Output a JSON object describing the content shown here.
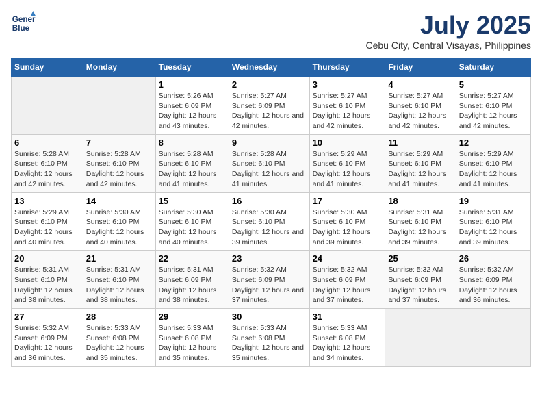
{
  "header": {
    "logo_line1": "General",
    "logo_line2": "Blue",
    "title": "July 2025",
    "subtitle": "Cebu City, Central Visayas, Philippines"
  },
  "calendar": {
    "headers": [
      "Sunday",
      "Monday",
      "Tuesday",
      "Wednesday",
      "Thursday",
      "Friday",
      "Saturday"
    ],
    "weeks": [
      [
        {
          "day": "",
          "sunrise": "",
          "sunset": "",
          "daylight": "",
          "empty": true
        },
        {
          "day": "",
          "sunrise": "",
          "sunset": "",
          "daylight": "",
          "empty": true
        },
        {
          "day": "1",
          "sunrise": "Sunrise: 5:26 AM",
          "sunset": "Sunset: 6:09 PM",
          "daylight": "Daylight: 12 hours and 43 minutes.",
          "empty": false
        },
        {
          "day": "2",
          "sunrise": "Sunrise: 5:27 AM",
          "sunset": "Sunset: 6:09 PM",
          "daylight": "Daylight: 12 hours and 42 minutes.",
          "empty": false
        },
        {
          "day": "3",
          "sunrise": "Sunrise: 5:27 AM",
          "sunset": "Sunset: 6:10 PM",
          "daylight": "Daylight: 12 hours and 42 minutes.",
          "empty": false
        },
        {
          "day": "4",
          "sunrise": "Sunrise: 5:27 AM",
          "sunset": "Sunset: 6:10 PM",
          "daylight": "Daylight: 12 hours and 42 minutes.",
          "empty": false
        },
        {
          "day": "5",
          "sunrise": "Sunrise: 5:27 AM",
          "sunset": "Sunset: 6:10 PM",
          "daylight": "Daylight: 12 hours and 42 minutes.",
          "empty": false
        }
      ],
      [
        {
          "day": "6",
          "sunrise": "Sunrise: 5:28 AM",
          "sunset": "Sunset: 6:10 PM",
          "daylight": "Daylight: 12 hours and 42 minutes.",
          "empty": false
        },
        {
          "day": "7",
          "sunrise": "Sunrise: 5:28 AM",
          "sunset": "Sunset: 6:10 PM",
          "daylight": "Daylight: 12 hours and 42 minutes.",
          "empty": false
        },
        {
          "day": "8",
          "sunrise": "Sunrise: 5:28 AM",
          "sunset": "Sunset: 6:10 PM",
          "daylight": "Daylight: 12 hours and 41 minutes.",
          "empty": false
        },
        {
          "day": "9",
          "sunrise": "Sunrise: 5:28 AM",
          "sunset": "Sunset: 6:10 PM",
          "daylight": "Daylight: 12 hours and 41 minutes.",
          "empty": false
        },
        {
          "day": "10",
          "sunrise": "Sunrise: 5:29 AM",
          "sunset": "Sunset: 6:10 PM",
          "daylight": "Daylight: 12 hours and 41 minutes.",
          "empty": false
        },
        {
          "day": "11",
          "sunrise": "Sunrise: 5:29 AM",
          "sunset": "Sunset: 6:10 PM",
          "daylight": "Daylight: 12 hours and 41 minutes.",
          "empty": false
        },
        {
          "day": "12",
          "sunrise": "Sunrise: 5:29 AM",
          "sunset": "Sunset: 6:10 PM",
          "daylight": "Daylight: 12 hours and 41 minutes.",
          "empty": false
        }
      ],
      [
        {
          "day": "13",
          "sunrise": "Sunrise: 5:29 AM",
          "sunset": "Sunset: 6:10 PM",
          "daylight": "Daylight: 12 hours and 40 minutes.",
          "empty": false
        },
        {
          "day": "14",
          "sunrise": "Sunrise: 5:30 AM",
          "sunset": "Sunset: 6:10 PM",
          "daylight": "Daylight: 12 hours and 40 minutes.",
          "empty": false
        },
        {
          "day": "15",
          "sunrise": "Sunrise: 5:30 AM",
          "sunset": "Sunset: 6:10 PM",
          "daylight": "Daylight: 12 hours and 40 minutes.",
          "empty": false
        },
        {
          "day": "16",
          "sunrise": "Sunrise: 5:30 AM",
          "sunset": "Sunset: 6:10 PM",
          "daylight": "Daylight: 12 hours and 39 minutes.",
          "empty": false
        },
        {
          "day": "17",
          "sunrise": "Sunrise: 5:30 AM",
          "sunset": "Sunset: 6:10 PM",
          "daylight": "Daylight: 12 hours and 39 minutes.",
          "empty": false
        },
        {
          "day": "18",
          "sunrise": "Sunrise: 5:31 AM",
          "sunset": "Sunset: 6:10 PM",
          "daylight": "Daylight: 12 hours and 39 minutes.",
          "empty": false
        },
        {
          "day": "19",
          "sunrise": "Sunrise: 5:31 AM",
          "sunset": "Sunset: 6:10 PM",
          "daylight": "Daylight: 12 hours and 39 minutes.",
          "empty": false
        }
      ],
      [
        {
          "day": "20",
          "sunrise": "Sunrise: 5:31 AM",
          "sunset": "Sunset: 6:10 PM",
          "daylight": "Daylight: 12 hours and 38 minutes.",
          "empty": false
        },
        {
          "day": "21",
          "sunrise": "Sunrise: 5:31 AM",
          "sunset": "Sunset: 6:10 PM",
          "daylight": "Daylight: 12 hours and 38 minutes.",
          "empty": false
        },
        {
          "day": "22",
          "sunrise": "Sunrise: 5:31 AM",
          "sunset": "Sunset: 6:09 PM",
          "daylight": "Daylight: 12 hours and 38 minutes.",
          "empty": false
        },
        {
          "day": "23",
          "sunrise": "Sunrise: 5:32 AM",
          "sunset": "Sunset: 6:09 PM",
          "daylight": "Daylight: 12 hours and 37 minutes.",
          "empty": false
        },
        {
          "day": "24",
          "sunrise": "Sunrise: 5:32 AM",
          "sunset": "Sunset: 6:09 PM",
          "daylight": "Daylight: 12 hours and 37 minutes.",
          "empty": false
        },
        {
          "day": "25",
          "sunrise": "Sunrise: 5:32 AM",
          "sunset": "Sunset: 6:09 PM",
          "daylight": "Daylight: 12 hours and 37 minutes.",
          "empty": false
        },
        {
          "day": "26",
          "sunrise": "Sunrise: 5:32 AM",
          "sunset": "Sunset: 6:09 PM",
          "daylight": "Daylight: 12 hours and 36 minutes.",
          "empty": false
        }
      ],
      [
        {
          "day": "27",
          "sunrise": "Sunrise: 5:32 AM",
          "sunset": "Sunset: 6:09 PM",
          "daylight": "Daylight: 12 hours and 36 minutes.",
          "empty": false
        },
        {
          "day": "28",
          "sunrise": "Sunrise: 5:33 AM",
          "sunset": "Sunset: 6:08 PM",
          "daylight": "Daylight: 12 hours and 35 minutes.",
          "empty": false
        },
        {
          "day": "29",
          "sunrise": "Sunrise: 5:33 AM",
          "sunset": "Sunset: 6:08 PM",
          "daylight": "Daylight: 12 hours and 35 minutes.",
          "empty": false
        },
        {
          "day": "30",
          "sunrise": "Sunrise: 5:33 AM",
          "sunset": "Sunset: 6:08 PM",
          "daylight": "Daylight: 12 hours and 35 minutes.",
          "empty": false
        },
        {
          "day": "31",
          "sunrise": "Sunrise: 5:33 AM",
          "sunset": "Sunset: 6:08 PM",
          "daylight": "Daylight: 12 hours and 34 minutes.",
          "empty": false
        },
        {
          "day": "",
          "sunrise": "",
          "sunset": "",
          "daylight": "",
          "empty": true
        },
        {
          "day": "",
          "sunrise": "",
          "sunset": "",
          "daylight": "",
          "empty": true
        }
      ]
    ]
  }
}
